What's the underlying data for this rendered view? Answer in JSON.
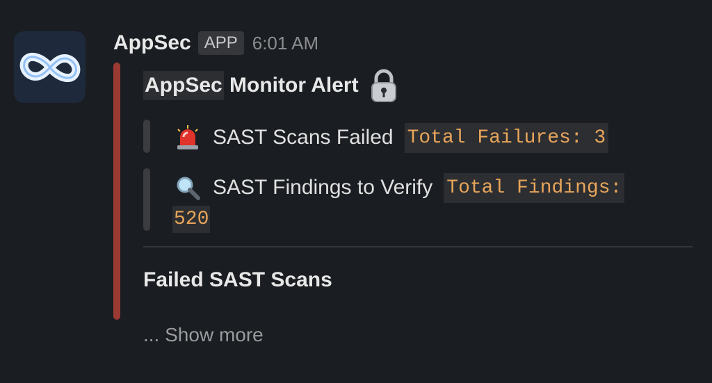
{
  "message": {
    "avatar_icon": "infinity-icon",
    "sender": "AppSec",
    "badge": "APP",
    "timestamp": "6:01 AM",
    "accent_color": "#9b3a33"
  },
  "alert": {
    "title_prefix": "AppSec",
    "title_rest": " Monitor Alert",
    "title_icon": "padlock-icon"
  },
  "items": [
    {
      "icon": "rotating-light-icon",
      "label": "SAST Scans Failed",
      "code": "Total Failures: 3"
    },
    {
      "icon": "magnifying-glass-icon",
      "label": "SAST Findings to Verify",
      "code": "Total Findings:",
      "code_cont": "520"
    }
  ],
  "section": {
    "title": "Failed SAST Scans"
  },
  "show_more": "... Show more"
}
